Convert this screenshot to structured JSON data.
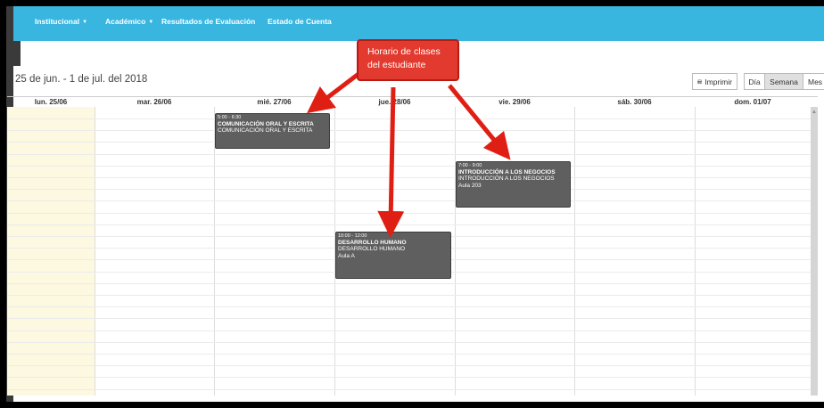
{
  "navbar": {
    "items": [
      {
        "label": "Institucional",
        "dropdown": true
      },
      {
        "label": "Académico",
        "dropdown": true
      },
      {
        "label": "Resultados de Evaluación",
        "dropdown": false
      },
      {
        "label": "Estado de Cuenta",
        "dropdown": false
      }
    ]
  },
  "calendar": {
    "range": "25 de jun. - 1 de jul. del 2018",
    "toolbar": {
      "print": "Imprimir",
      "day": "Día",
      "week": "Semana",
      "month": "Mes"
    },
    "days": [
      "lun. 25/06",
      "mar. 26/06",
      "mié. 27/06",
      "jue. 28/06",
      "vie. 29/06",
      "sáb. 30/06",
      "dom. 01/07"
    ],
    "events": [
      {
        "time": "5:00 - 6:30",
        "title": "COMUNICACIÓN ORAL Y ESCRITA",
        "line2": "COMUNICACIÓN ORAL Y ESCRITA",
        "room": ""
      },
      {
        "time": "7:00 - 9:00",
        "title": "INTRODUCCIÓN A LOS NEGOCIOS",
        "line2": "INTRODUCCIÓN A LOS NEGOCIOS",
        "room": "Aula 203"
      },
      {
        "time": "10:00 - 12:00",
        "title": "DESARROLLO HUMANO",
        "line2": "DESARROLLO HUMANO",
        "room": "Aula A"
      }
    ]
  },
  "annotation": {
    "line1": "Horario de clases",
    "line2": "del estudiante"
  },
  "colors": {
    "navbar": "#38b6e0",
    "event": "#5f5f5f",
    "callout": "#e23a2e",
    "today": "#fdf8e0"
  }
}
